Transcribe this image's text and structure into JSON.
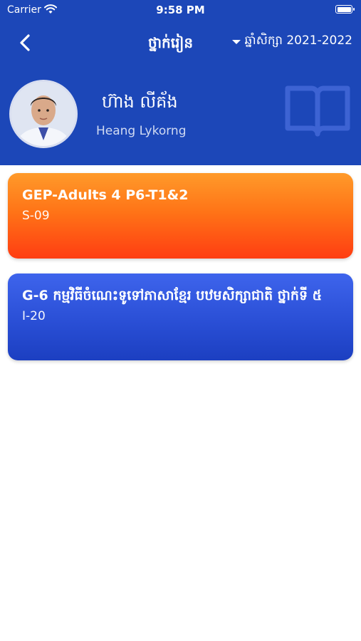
{
  "status_bar": {
    "carrier": "Carrier",
    "time": "9:58 PM",
    "battery_level": 1.0
  },
  "nav": {
    "back_icon": "chevron-left-icon",
    "title": "ថ្នាក់រៀន",
    "year_label": "ឆ្នាំសិក្សា 2021-2022"
  },
  "profile": {
    "name_kh": "ហ៊ាង លីគ័ង",
    "name_en": "Heang Lykorng",
    "decor_icon": "open-book-icon"
  },
  "classes": [
    {
      "title": "GEP-Adults 4 P6-T1&2",
      "code": "S-09",
      "color": "#ff7417"
    },
    {
      "title": "G-6 កម្មវិធីចំណេះទូទៅភាសាខ្មែរ បឋមសិក្សាជាតិ ថ្នាក់ទី ៥",
      "code": "I-20",
      "color": "#2a4fd6"
    }
  ],
  "colors": {
    "header_bg": "#1c47b8",
    "page_bg": "#ffffff"
  }
}
